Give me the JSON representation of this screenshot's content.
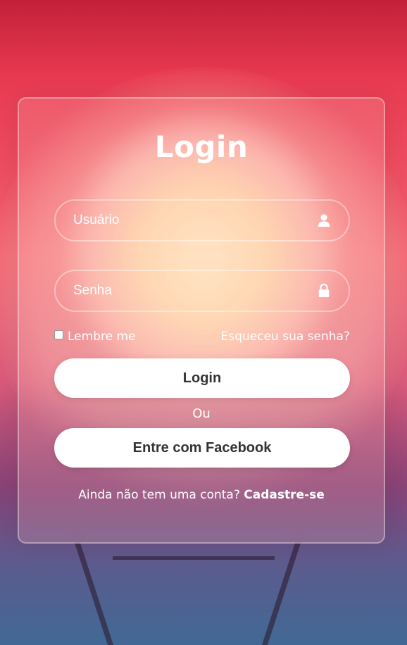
{
  "login_form": {
    "title": "Login",
    "username": {
      "placeholder": "Usuário",
      "value": "",
      "icon": "user-icon"
    },
    "password": {
      "placeholder": "Senha",
      "value": "",
      "icon": "lock-icon"
    },
    "remember_label": "Lembre me",
    "remember_checked": false,
    "forgot_label": "Esqueceu sua senha?",
    "login_button_label": "Login",
    "or_label": "Ou",
    "facebook_button_label": "Entre com Facebook",
    "signup_prompt": "Ainda não tem uma conta?",
    "signup_link_label": "Cadastre-se"
  },
  "colors": {
    "background_top": "#c2203a",
    "background_bottom": "#4a7aa0",
    "button_background": "#ffffff",
    "button_text": "#333333",
    "text": "#ffffff"
  }
}
